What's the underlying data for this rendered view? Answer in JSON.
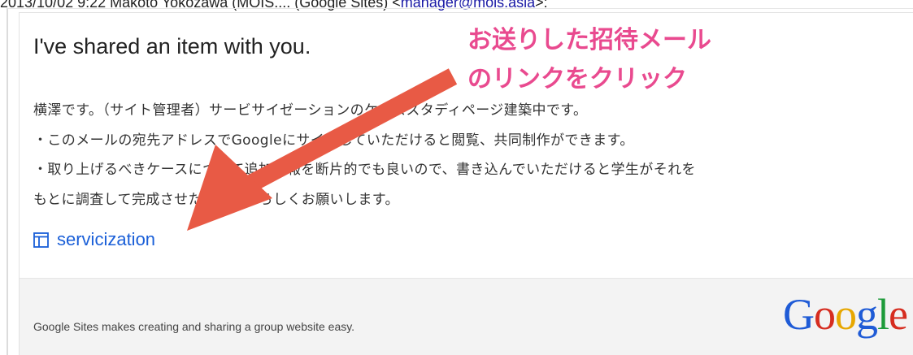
{
  "header": {
    "line_text": "2013/10/02 9:22  Makoto Yokozawa (MOIS.... (Google Sites)  <",
    "email": "manager@mois.asia",
    "suffix": ">:"
  },
  "email": {
    "title": "I've shared an item with you.",
    "body_lines": [
      "横澤です。（サイト管理者）サービサイゼーションのケーススタディページ建築中です。",
      "・このメールの宛先アドレスでGoogleにサインしていただけると閲覧、共同制作ができます。",
      "・取り上げるべきケースについて追加情報を断片的でも良いので、書き込んでいただけると学生がそれを",
      "もとに調査して完成させたいのでよろしくお願いします。"
    ],
    "link": {
      "icon": "sites-page-icon",
      "label": "servicization"
    },
    "footer_text": "Google Sites makes creating and sharing a group website easy.",
    "logo": "Google"
  },
  "annotation": {
    "line1": "お送りした招待メール",
    "line2": "のリンクをクリック",
    "color": "#e94a8f",
    "arrow_color": "#e85a45"
  }
}
